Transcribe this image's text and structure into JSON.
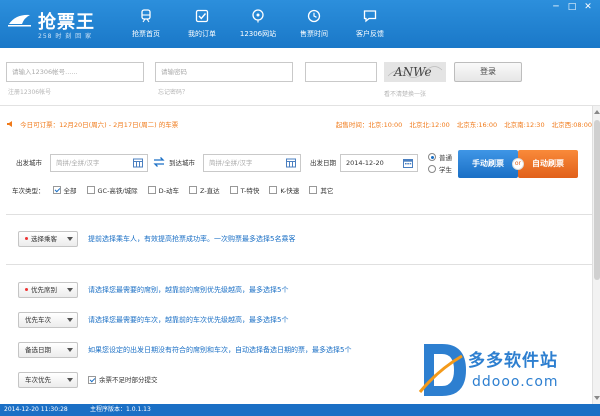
{
  "app": {
    "logo_text": "抢票王",
    "logo_sub": "258 时 刻 回 家"
  },
  "nav": [
    {
      "label": "抢票首页",
      "icon": "train-icon"
    },
    {
      "label": "我的订单",
      "icon": "checkbox-icon"
    },
    {
      "label": "12306网站",
      "icon": "globe-icon"
    },
    {
      "label": "售票时间",
      "icon": "clock-icon"
    },
    {
      "label": "客户反馈",
      "icon": "chat-icon"
    }
  ],
  "window": {
    "min": "─",
    "max": "□",
    "close": "✕"
  },
  "login": {
    "account_placeholder": "请输入12306帐号......",
    "account_hint": "注册12306帐号",
    "password_placeholder": "请输密码",
    "password_hint": "忘记密码？",
    "captcha_text": "ANWe",
    "captcha_hint": "看不清楚换一张",
    "login_button": "登录"
  },
  "notice": {
    "text": "今日可订票：12月20日(周六) - 2月17日(周二) 的车票",
    "times": [
      "起售时间：北京:10:00",
      "北京北:12:00",
      "北京东:16:00",
      "北京南:12:30",
      "北京西:08:00"
    ]
  },
  "search": {
    "from_label": "出发城市",
    "from_placeholder": "简拼/全拼/汉字",
    "to_label": "到达城市",
    "to_placeholder": "简拼/全拼/汉字",
    "date_label": "出发日期",
    "date_value": "2014-12-20",
    "radio_normal": "普通",
    "radio_student": "学生",
    "manual_button": "手动刷票",
    "auto_button": "自动刷票",
    "or_label": "or"
  },
  "train_types": {
    "label": "车次类型：",
    "items": [
      {
        "label": "全部",
        "checked": true
      },
      {
        "label": "GC-高铁/城际",
        "checked": false
      },
      {
        "label": "D-动车",
        "checked": false
      },
      {
        "label": "Z-直达",
        "checked": false
      },
      {
        "label": "T-特快",
        "checked": false
      },
      {
        "label": "K-快速",
        "checked": false
      },
      {
        "label": "其它",
        "checked": false
      }
    ]
  },
  "options": {
    "passenger_button": "选择乘客",
    "passenger_text": "提前选择乘车人，有效提高抢票成功率。一次购票最多选择5名乘客",
    "seat_button": "优先席别",
    "seat_text": "请选择您最需要的席别，越靠前的席别优先级越高，最多选择5个",
    "train_button": "优先车次",
    "train_text": "请选择您最需要的车次，越靠前的车次优先级越高，最多选择5个",
    "date_button": "备选日期",
    "date_text": "如果您设定的出发日期没有符合的席别和车次，自动选择备选日期的票，最多选择5个",
    "train_pref_button": "车次优先",
    "partial_submit": "余票不足时部分提交"
  },
  "watermark": {
    "cn": "多多软件站",
    "url": "ddooo.com"
  },
  "status": {
    "time": "2014-12-20 11:30:28",
    "version": "主程序版本：1.0.1.13"
  },
  "colors": {
    "header_blue": "#1a78c8",
    "accent_orange": "#e1601a",
    "link_blue": "#1a6fc5"
  }
}
